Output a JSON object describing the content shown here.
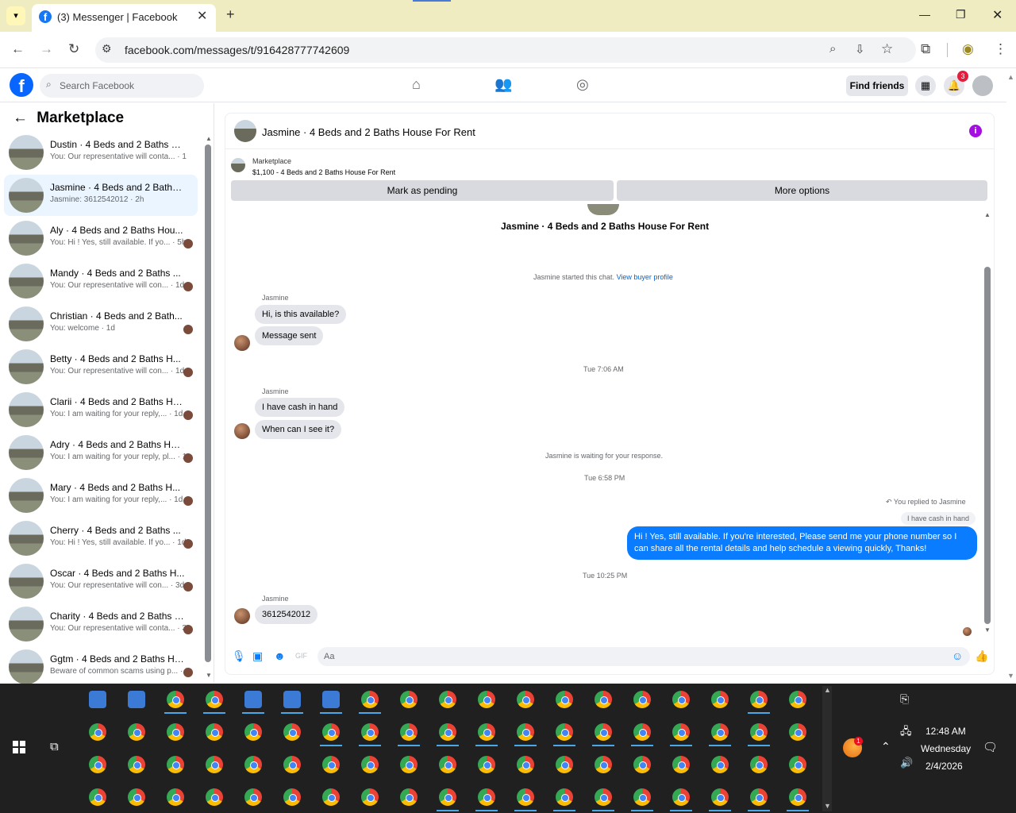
{
  "browser": {
    "tab_title": "(3) Messenger | Facebook",
    "tab_favicon": "f",
    "url": "facebook.com/messages/t/916428777742609"
  },
  "fb": {
    "search_placeholder": "Search Facebook",
    "find_friends": "Find friends",
    "notif_count": "3"
  },
  "sidebar": {
    "title": "Marketplace",
    "conversations": [
      {
        "name": "Dustin · 4 Beds and 2 Baths Ho...",
        "preview": "You: Our representative will conta... · 1m",
        "selected": false
      },
      {
        "name": "Jasmine · 4 Beds and 2 Baths H...",
        "preview": "Jasmine: 3612542012 · 2h",
        "selected": true
      },
      {
        "name": "Aly · 4 Beds and 2 Baths Hou...",
        "preview": "You: Hi ! Yes, still available. If yo... · 5h",
        "selected": false
      },
      {
        "name": "Mandy · 4 Beds and 2 Baths ...",
        "preview": "You: Our representative will con... · 1d",
        "selected": false
      },
      {
        "name": "Christian · 4 Beds and 2 Bath...",
        "preview": "You: welcome · 1d",
        "selected": false
      },
      {
        "name": "Betty · 4 Beds and 2 Baths H...",
        "preview": "You: Our representative will con... · 1d",
        "selected": false
      },
      {
        "name": "Clarii · 4 Beds and 2 Baths Ho...",
        "preview": "You: I am waiting for your reply,... · 1d",
        "selected": false
      },
      {
        "name": "Adry · 4 Beds and 2 Baths Hous...",
        "preview": "You: I am waiting for your reply, pl... · 1d",
        "selected": false
      },
      {
        "name": "Mary · 4 Beds and 2 Baths H...",
        "preview": "You: I am waiting for your reply,... · 1d",
        "selected": false
      },
      {
        "name": "Cherry · 4 Beds and 2 Baths ...",
        "preview": "You: Hi ! Yes, still available. If yo... · 1d",
        "selected": false
      },
      {
        "name": "Oscar · 4 Beds and 2 Baths H...",
        "preview": "You: Our representative will con... · 3d",
        "selected": false
      },
      {
        "name": "Charity · 4 Beds and 2 Baths Ho...",
        "preview": "You: Our representative will conta... · 3d",
        "selected": false
      },
      {
        "name": "Ggtm · 4 Beds and 2 Baths Hou...",
        "preview": "Beware of common scams using p... · 3d",
        "selected": false
      }
    ]
  },
  "chat": {
    "header_name": "Jasmine · 4 Beds and 2 Baths House For Rent",
    "mp_label": "Marketplace",
    "mp_listing": "$1,100 - 4 Beds and 2 Baths House For Rent",
    "btn_pending": "Mark as pending",
    "btn_more": "More options",
    "title_center": "Jasmine · 4 Beds and 2 Baths House For Rent",
    "started": "Jasmine started this chat.",
    "view_profile": "View buyer profile",
    "sender": "Jasmine",
    "m1": "Hi, is this available?",
    "m2": "Message sent",
    "t1": "Tue 7:06 AM",
    "m3": "I have cash in hand",
    "m4": "When can I see it?",
    "waiting": "Jasmine is waiting for your response.",
    "t2": "Tue 6:58 PM",
    "replied": "You replied to Jasmine",
    "quoted": "I have cash in hand",
    "outgoing": "Hi ! Yes, still available. If you're interested, Please send me your phone number so I can share all the rental details and help schedule a viewing quickly, Thanks!",
    "t3": "Tue 10:25 PM",
    "m5": "3612542012",
    "composer_placeholder": "Aa"
  },
  "taskbar": {
    "time": "12:48 AM",
    "day": "Wednesday",
    "date": "2/4/2026",
    "notif_badge": "1"
  }
}
